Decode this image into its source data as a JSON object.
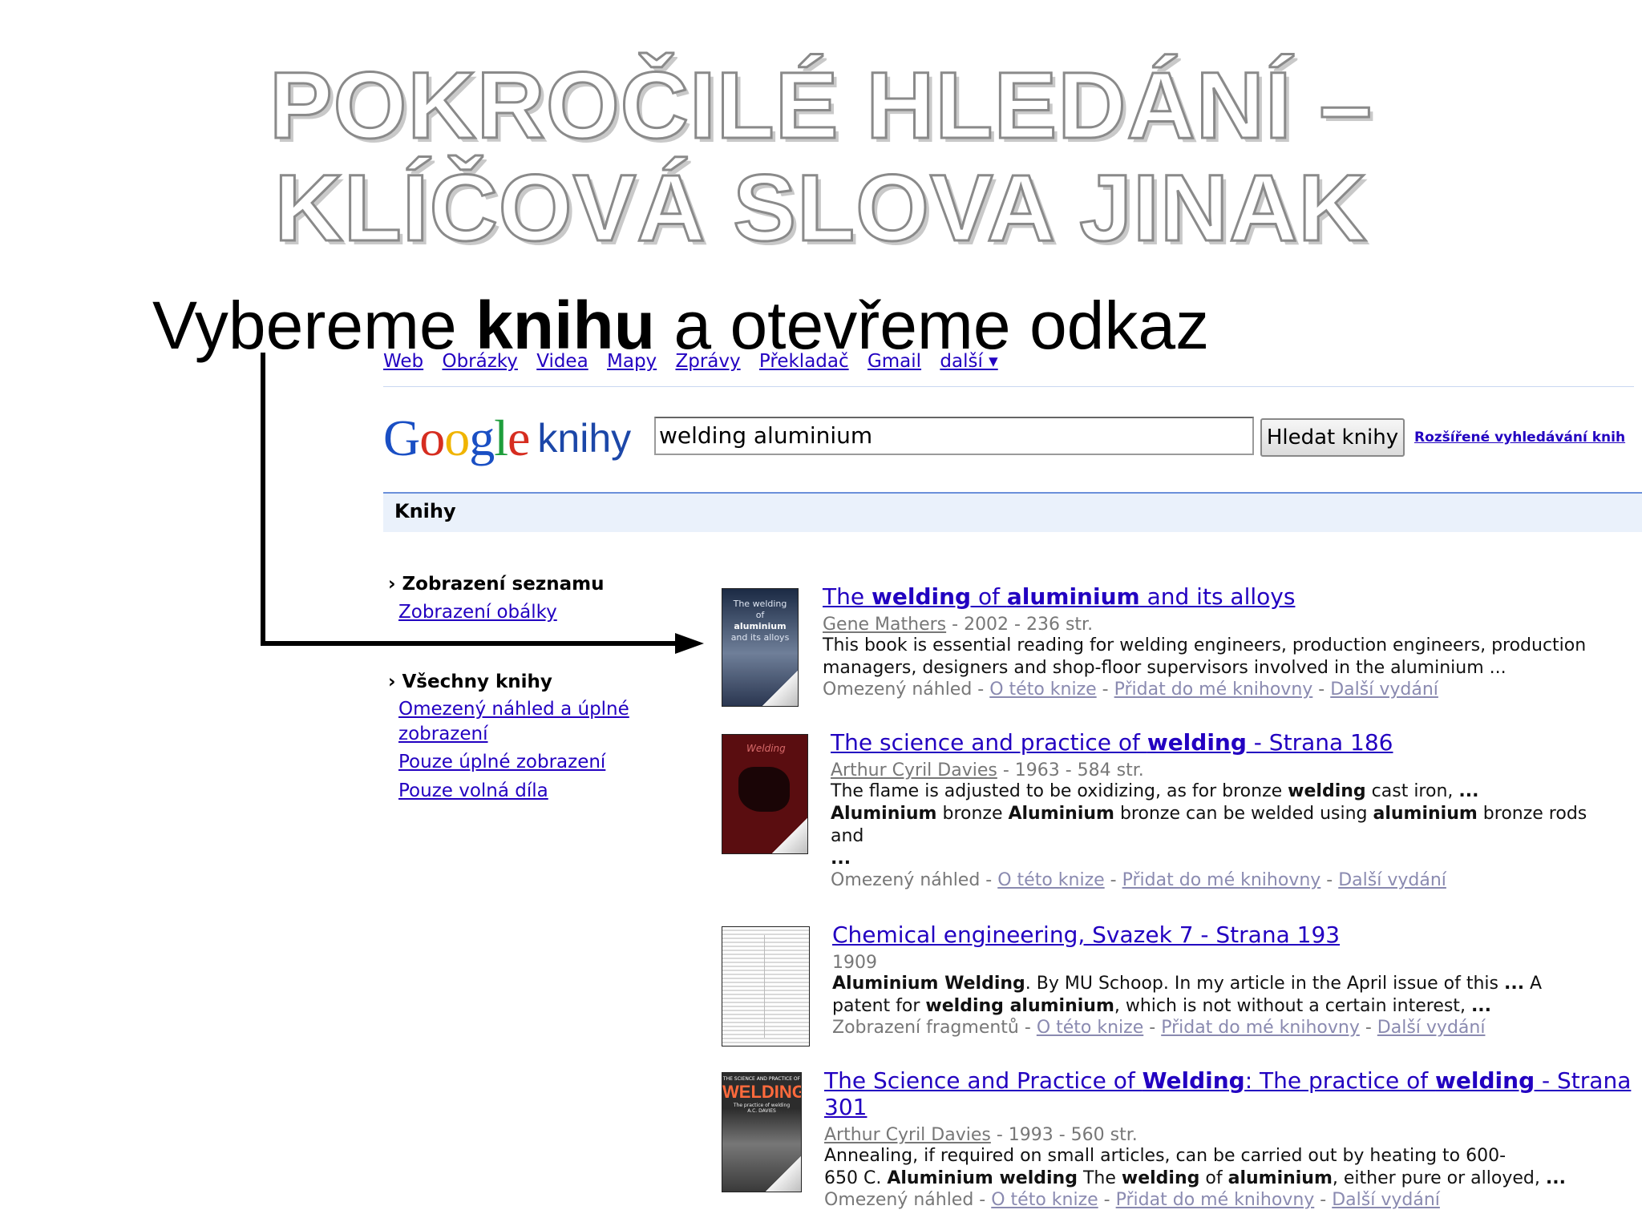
{
  "slide": {
    "title_line1": "POKROČILÉ HLEDÁNÍ –",
    "title_line2": "KLÍČOVÁ SLOVA JINAK",
    "subtitle_before": "Vybereme ",
    "subtitle_bold": "knihu",
    "subtitle_after": " a otevřeme odkaz"
  },
  "nav": {
    "items": [
      "Web",
      "Obrázky",
      "Videa",
      "Mapy",
      "Zprávy",
      "Překladač",
      "Gmail",
      "další ▾"
    ]
  },
  "logo": {
    "google": "Google",
    "knihy": "knihy"
  },
  "search": {
    "query": "welding aluminium",
    "button": "Hledat knihy",
    "advanced": "Rozšířené vyhledávání knih"
  },
  "section_bar": "Knihy",
  "sidebar": {
    "view_head": "› Zobrazení seznamu",
    "view_alt": "Zobrazení obálky",
    "filter_head": "› Všechny knihy",
    "filter_items": [
      "Omezený náhled a úplné",
      "zobrazení",
      "Pouze úplné zobrazení",
      "Pouze volná díla"
    ]
  },
  "results": [
    {
      "title": [
        "The ",
        "welding",
        " of ",
        "aluminium",
        " and its alloys"
      ],
      "author": "Gene Mathers",
      "meta": " - 2002 - 236 str.",
      "desc": [
        "This book is essential reading for welding engineers, production engineers, production",
        "managers, designers and shop-floor supervisors involved in the aluminium ..."
      ],
      "preview": "Omezený náhled",
      "cover_text": [
        "The welding",
        "of",
        "aluminium",
        "and its alloys"
      ]
    },
    {
      "title": [
        "The science and practice of ",
        "welding",
        " - Strana 186"
      ],
      "author": "Arthur Cyril Davies",
      "meta": " - 1963 - 584 str.",
      "desc_html_parts": [
        [
          "The flame is adjusted to be oxidizing, as for bronze ",
          "welding",
          " cast iron, ",
          "..."
        ],
        [
          "",
          "Aluminium",
          " bronze ",
          "Aluminium",
          " bronze can be welded using ",
          "aluminium",
          " bronze rods"
        ],
        [
          "and"
        ],
        [
          "..."
        ]
      ],
      "preview": "Omezený náhled",
      "cover_text": [
        "Welding"
      ]
    },
    {
      "title": [
        "Chemical engineering, Svazek 7 - Strana 193"
      ],
      "meta": "1909",
      "desc_lines": [
        [
          "Aluminium Welding",
          ". By MU Schoop. In my article in the April issue of this ",
          "...",
          " A"
        ],
        [
          "patent for ",
          "welding aluminium",
          ", which is not without a certain interest, ",
          "..."
        ]
      ],
      "preview": "Zobrazení fragmentů"
    },
    {
      "title": [
        "The Science and Practice of ",
        "Welding",
        ": The practice of ",
        "welding",
        " - Strana"
      ],
      "title2": "301",
      "author": "Arthur Cyril Davies",
      "meta": " - 1993 - 560 str.",
      "desc_lines": [
        [
          "Annealing, if required on small articles, can be carried out by heating to 600-"
        ],
        [
          "650 C. ",
          "Aluminium welding",
          " The ",
          "welding",
          " of ",
          "aluminium",
          ", either pure or alloyed, ",
          "..."
        ]
      ],
      "preview": "Omezený náhled",
      "cover_text": [
        "THE SCIENCE AND PRACTICE OF",
        "WELDING",
        "The practice of welding",
        "A.C. DAVIES"
      ]
    }
  ],
  "links": {
    "about": "O této knize",
    "add": "Přidat do mé knihovny",
    "editions": "Další vydání",
    "sep": " - "
  }
}
